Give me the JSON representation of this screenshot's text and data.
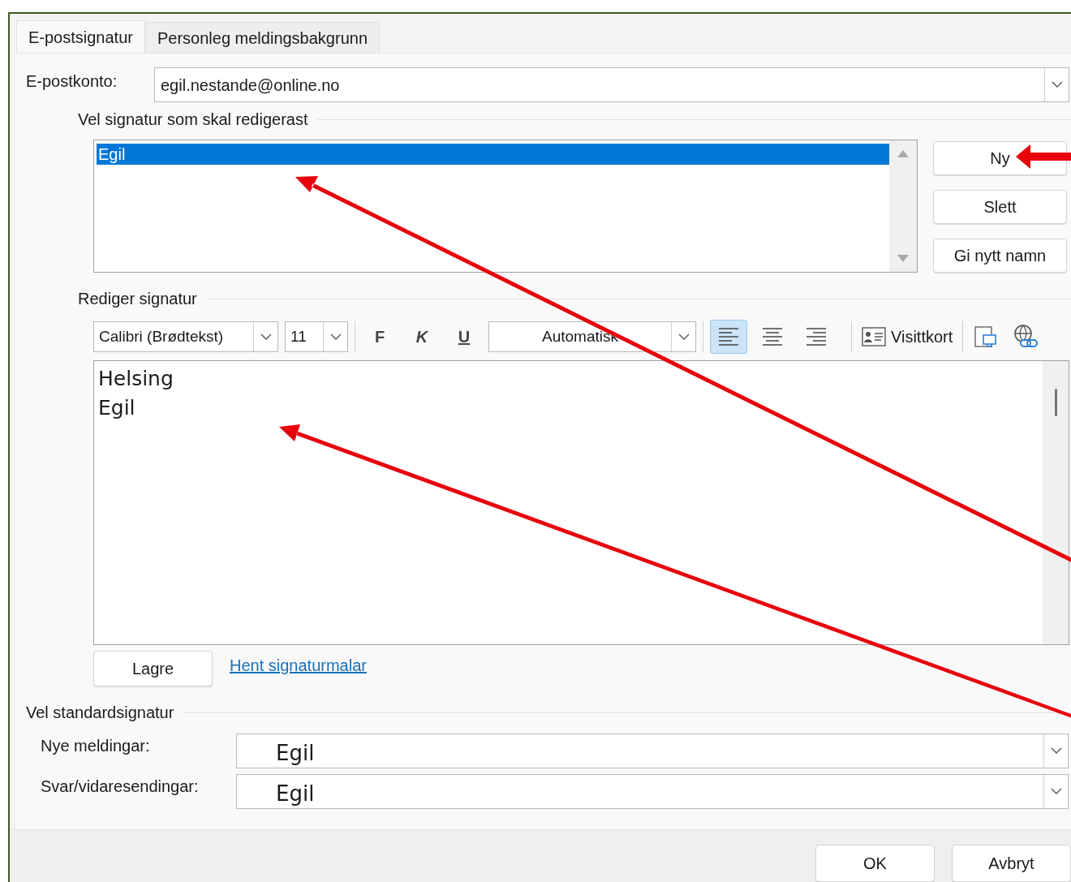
{
  "tabs": [
    {
      "label": "E-postsignatur",
      "selected": true
    },
    {
      "label": "Personleg meldingsbakgrunn",
      "selected": false
    }
  ],
  "account": {
    "label": "E-postkonto:",
    "value": "egil.nestande@online.no"
  },
  "signature_list": {
    "heading": "Vel signatur som skal redigerast",
    "items": [
      {
        "label": "Egil",
        "selected": true
      }
    ]
  },
  "list_buttons": [
    "Ny",
    "Slett",
    "Gi nytt namn"
  ],
  "editor": {
    "heading": "Rediger signatur",
    "font": "Calibri (Brødtekst)",
    "size": "11",
    "bold": "F",
    "italic": "K",
    "underline": "U",
    "font_color": "Automatisk",
    "align": [
      {
        "kind": "left",
        "selected": true
      },
      {
        "kind": "center",
        "selected": false
      },
      {
        "kind": "right",
        "selected": false
      }
    ],
    "business_card": "Visittkort",
    "lines": [
      "Helsing",
      "Egil"
    ]
  },
  "save_button": "Lagre",
  "template_link": "Hent signaturmalar",
  "defaults": {
    "heading": "Vel standardsignatur",
    "rows": [
      {
        "label": "Nye meldingar:",
        "value": "Egil"
      },
      {
        "label": "Svar/vidaresendingar:",
        "value": "Egil"
      }
    ]
  },
  "dialog_buttons": [
    "OK",
    "Avbryt"
  ]
}
